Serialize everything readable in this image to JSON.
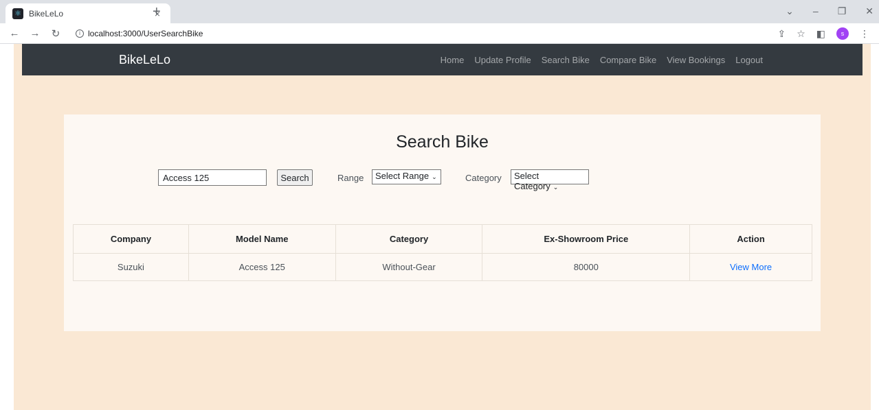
{
  "browser": {
    "tab_title": "BikeLeLo",
    "tab_close": "×",
    "new_tab": "+",
    "url": "localhost:3000/UserSearchBike",
    "profile_initial": "s"
  },
  "navbar": {
    "brand": "BikeLeLo",
    "links": [
      "Home",
      "Update Profile",
      "Search Bike",
      "Compare Bike",
      "View Bookings",
      "Logout"
    ]
  },
  "search": {
    "title": "Search Bike",
    "query_value": "Access 125",
    "search_button": "Search",
    "range_label": "Range",
    "range_selected": "Select Range",
    "category_label": "Category",
    "category_selected": "Select Category"
  },
  "table": {
    "headers": [
      "Company",
      "Model Name",
      "Category",
      "Ex-Showroom Price",
      "Action"
    ],
    "rows": [
      [
        "Suzuki",
        "Access 125",
        "Without-Gear",
        "80000",
        "View More"
      ]
    ]
  },
  "colors": {
    "page_bg": "#fae8d4",
    "navbar_bg": "#343a40",
    "link": "#0d6efd"
  }
}
